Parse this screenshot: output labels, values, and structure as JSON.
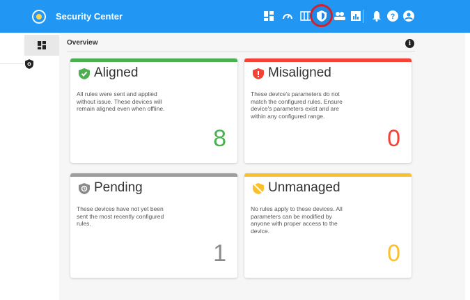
{
  "header": {
    "title": "Security Center",
    "icons": [
      "dashboard-icon",
      "speed-icon",
      "table-icon",
      "shield-icon",
      "group-icon",
      "report-icon",
      "bell-icon",
      "help-icon",
      "account-icon"
    ],
    "background": "#2196f3",
    "active_ring_color": "#d5202a"
  },
  "sidebar": {
    "items": [
      {
        "icon": "dashboard-icon",
        "active": true
      },
      {
        "icon": "shield-icon",
        "active": false
      }
    ]
  },
  "main": {
    "section_title": "Overview",
    "cards": [
      {
        "title": "Aligned",
        "icon": "check-shield-icon",
        "color": "#4caf50",
        "description": "All rules were sent and applied without issue. These devices will remain aligned even when offline.",
        "count": "8"
      },
      {
        "title": "Misaligned",
        "icon": "alert-shield-icon",
        "color": "#f44336",
        "description": "These device's parameters do not match the configured rules. Ensure device's parameters exist and are within any configured range.",
        "count": "0"
      },
      {
        "title": "Pending",
        "icon": "pending-shield-icon",
        "color": "#9e9e9e",
        "description": "These devices have not yet been sent the most recently configured rules.",
        "count": "1"
      },
      {
        "title": "Unmanaged",
        "icon": "unmanaged-shield-icon",
        "color": "#fbc02d",
        "description": "No rules apply to these devices. All parameters can be modified by anyone with proper access to the device.",
        "count": "0"
      }
    ]
  }
}
